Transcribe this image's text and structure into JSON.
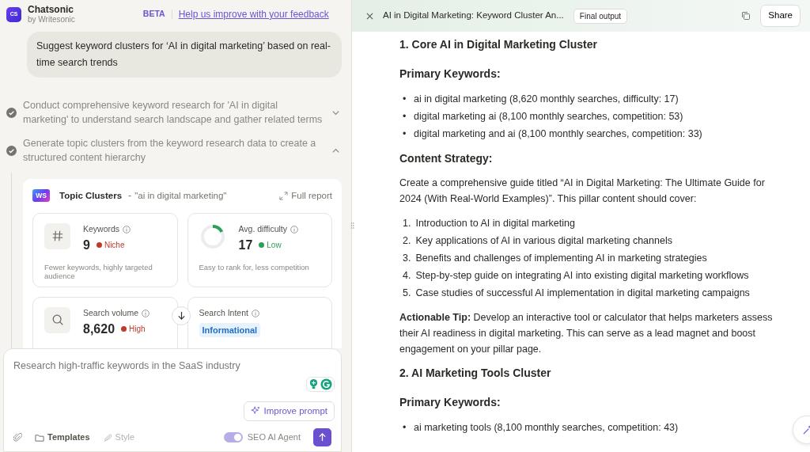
{
  "app": {
    "logo": "CS",
    "name": "Chatsonic",
    "byline": "by Writesonic",
    "beta": "BETA",
    "feedback_link": "Help us improve with your feedback"
  },
  "user_message": "Suggest keyword clusters for ‘AI in digital marketing’ based on real-time search trends",
  "steps": [
    {
      "text": "Conduct comprehensive keyword research for 'AI in digital marketing' to understand search landscape and gather related terms",
      "done": true,
      "expanded": false
    },
    {
      "text": "Generate topic clusters from the keyword research data to create a structured content hierarchy",
      "done": true,
      "expanded": true
    }
  ],
  "report": {
    "logo": "WS",
    "title": "Topic Clusters",
    "separator": "-",
    "query": "\"ai in digital marketing\"",
    "action": "Full report",
    "metrics": [
      {
        "kind": "count",
        "label": "Keywords",
        "value": "9",
        "badge": "Niche",
        "color": "#c0392b",
        "description": "Fewer keywords, highly targeted audience"
      },
      {
        "kind": "ring",
        "level": 0.17,
        "label": "Avg. difficulty",
        "value": "17",
        "badge": "Low",
        "color": "#2e9e5b",
        "description": "Easy to rank for, less competition"
      },
      {
        "kind": "volume",
        "label": "Search volume",
        "value": "8,620",
        "badge": "High",
        "color": "#c0392b"
      },
      {
        "kind": "tag",
        "label": "Search Intent",
        "tag": "Informational"
      }
    ]
  },
  "composer": {
    "placeholder": "Research high-traffic keywords in the SaaS industry",
    "improve": "Improve prompt",
    "tools": [
      {
        "label": "Templates",
        "disabled": false
      },
      {
        "label": "Style",
        "disabled": true
      }
    ],
    "agent": {
      "label": "SEO AI Agent",
      "on": true
    }
  },
  "document": {
    "title": "AI in Digital Marketing: Keyword Cluster An...",
    "badge": "Final output",
    "share": "Share",
    "blocks": [
      {
        "kind": "h2",
        "text": "1. Core AI in Digital Marketing Cluster"
      },
      {
        "kind": "h3",
        "text": "Primary Keywords:"
      },
      {
        "kind": "list",
        "items": [
          {
            "marker": "•",
            "text": "ai in digital marketing (8,620 monthly searches, difficulty: 17)"
          },
          {
            "marker": "•",
            "text": "digital marketing ai (8,100 monthly searches, competition: 53)"
          },
          {
            "marker": "•",
            "text": "digital marketing and ai (8,100 monthly searches, competition: 33)"
          }
        ]
      },
      {
        "kind": "h3",
        "text": "Content Strategy:"
      },
      {
        "kind": "p",
        "text": "Create a comprehensive guide titled “AI in Digital Marketing: The Ultimate Guide for 2024 (With Real-World Examples)”. This pillar content should cover:"
      },
      {
        "kind": "list",
        "items": [
          {
            "marker": "1.",
            "text": "Introduction to AI in digital marketing"
          },
          {
            "marker": "2.",
            "text": "Key applications of AI in various digital marketing channels"
          },
          {
            "marker": "3.",
            "text": "Benefits and challenges of implementing AI in marketing strategies"
          },
          {
            "marker": "4.",
            "text": "Step-by-step guide on integrating AI into existing digital marketing workflows"
          },
          {
            "marker": "5.",
            "text": "Case studies of successful AI implementation in digital marketing campaigns"
          }
        ]
      },
      {
        "kind": "p",
        "text": "**Actionable Tip:** Develop an interactive tool or calculator that helps marketers assess their AI readiness in digital marketing. This can serve as a lead magnet and boost engagement on your pillar page."
      },
      {
        "kind": "h2",
        "text": "2. AI Marketing Tools Cluster"
      },
      {
        "kind": "h3",
        "text": "Primary Keywords:"
      },
      {
        "kind": "list",
        "items": [
          {
            "marker": "•",
            "text": "ai marketing tools (8,100 monthly searches, competition: 43)"
          }
        ]
      }
    ]
  }
}
